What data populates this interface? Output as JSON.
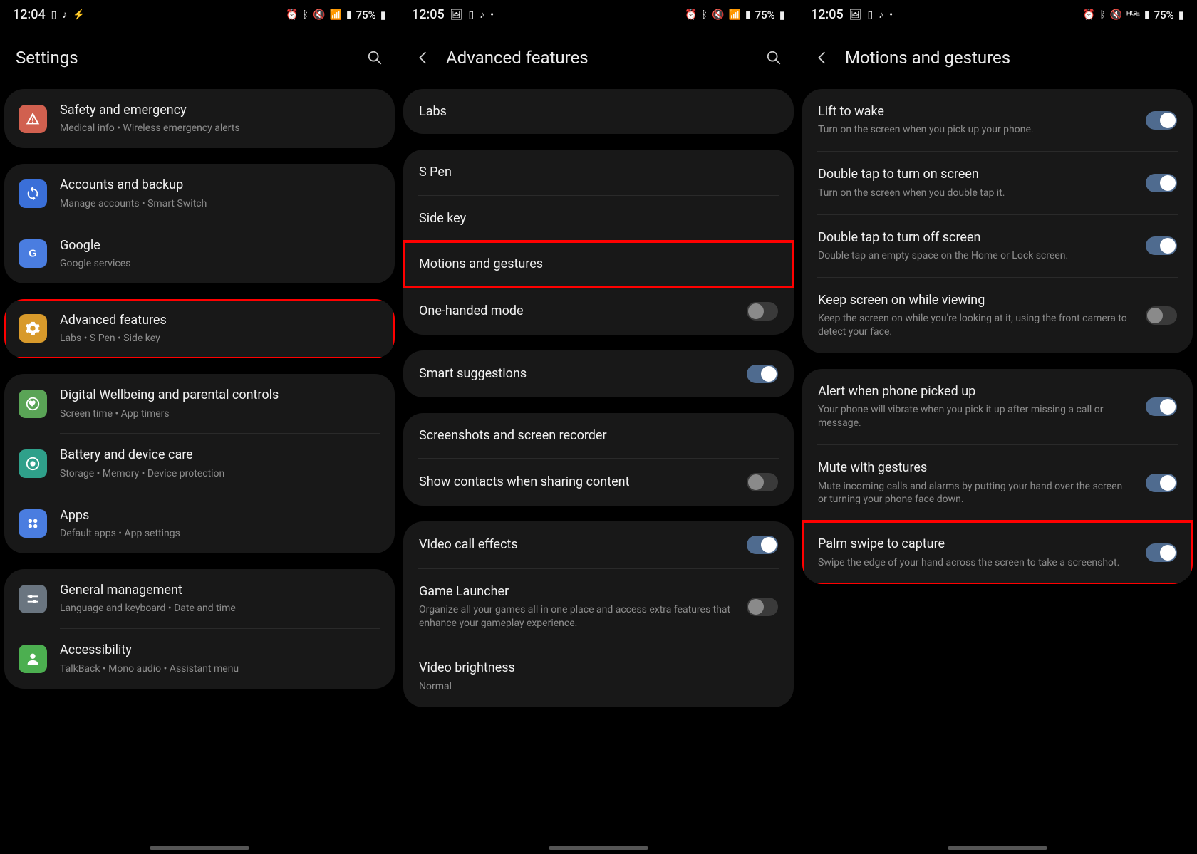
{
  "phones": [
    {
      "status": {
        "time": "12:04",
        "left_icons": [
          "sim-icon",
          "music-icon",
          "charging-icon"
        ],
        "right_icons": [
          "alarm",
          "bt",
          "mute",
          "wifi",
          "signal"
        ],
        "battery": "75%"
      },
      "title": "Settings",
      "has_back": false,
      "has_search": true,
      "sections": [
        {
          "items": [
            {
              "icon": "alert",
              "icon_bg": "bg-red",
              "title": "Safety and emergency",
              "subtitle": "Medical info  •  Wireless emergency alerts",
              "highlight": false
            }
          ]
        },
        {
          "items": [
            {
              "icon": "sync",
              "icon_bg": "bg-blue",
              "title": "Accounts and backup",
              "subtitle": "Manage accounts  •  Smart Switch"
            },
            {
              "icon": "google",
              "icon_bg": "bg-bluelight",
              "title": "Google",
              "subtitle": "Google services"
            }
          ]
        },
        {
          "items": [
            {
              "icon": "gear",
              "icon_bg": "bg-orange",
              "title": "Advanced features",
              "subtitle": "Labs  •  S Pen  •  Side key",
              "highlight": true
            }
          ]
        },
        {
          "items": [
            {
              "icon": "heart",
              "icon_bg": "bg-green",
              "title": "Digital Wellbeing and parental controls",
              "subtitle": "Screen time  •  App timers"
            },
            {
              "icon": "care",
              "icon_bg": "bg-teal",
              "title": "Battery and device care",
              "subtitle": "Storage  •  Memory  •  Device protection"
            },
            {
              "icon": "apps",
              "icon_bg": "bg-blue2",
              "title": "Apps",
              "subtitle": "Default apps  •  App settings"
            }
          ]
        },
        {
          "items": [
            {
              "icon": "sliders",
              "icon_bg": "bg-grey",
              "title": "General management",
              "subtitle": "Language and keyboard  •  Date and time"
            },
            {
              "icon": "person",
              "icon_bg": "bg-green2",
              "title": "Accessibility",
              "subtitle": "TalkBack  •  Mono audio  •  Assistant menu"
            }
          ]
        }
      ]
    },
    {
      "status": {
        "time": "12:05",
        "left_icons": [
          "image-icon",
          "sim-icon",
          "music-icon",
          "dot-icon"
        ],
        "right_icons": [
          "alarm",
          "bt",
          "mute",
          "wifi",
          "signal"
        ],
        "battery": "75%"
      },
      "title": "Advanced features",
      "has_back": true,
      "has_search": true,
      "sections": [
        {
          "simple": true,
          "items": [
            {
              "title": "Labs"
            }
          ]
        },
        {
          "simple": true,
          "items": [
            {
              "title": "S Pen"
            },
            {
              "title": "Side key"
            },
            {
              "title": "Motions and gestures",
              "highlight": true
            },
            {
              "title": "One-handed mode",
              "toggle": "off"
            }
          ]
        },
        {
          "simple": true,
          "items": [
            {
              "title": "Smart suggestions",
              "toggle": "on"
            }
          ]
        },
        {
          "simple": true,
          "items": [
            {
              "title": "Screenshots and screen recorder"
            },
            {
              "title": "Show contacts when sharing content",
              "toggle": "off"
            }
          ]
        },
        {
          "simple": true,
          "items": [
            {
              "title": "Video call effects",
              "toggle": "on"
            },
            {
              "title": "Game Launcher",
              "subtitle": "Organize all your games all in one place and access extra features that enhance your gameplay experience.",
              "toggle": "off"
            },
            {
              "title": "Video brightness",
              "subtitle": "Normal"
            }
          ]
        }
      ]
    },
    {
      "status": {
        "time": "12:05",
        "left_icons": [
          "image-icon",
          "sim-icon",
          "music-icon",
          "dot-icon"
        ],
        "right_icons": [
          "alarm",
          "bt",
          "mute",
          "4g",
          "signal"
        ],
        "battery": "75%"
      },
      "title": "Motions and gestures",
      "has_back": true,
      "has_search": false,
      "sections": [
        {
          "simple": true,
          "items": [
            {
              "title": "Lift to wake",
              "subtitle": "Turn on the screen when you pick up your phone.",
              "toggle": "on"
            },
            {
              "title": "Double tap to turn on screen",
              "subtitle": "Turn on the screen when you double tap it.",
              "toggle": "on"
            },
            {
              "title": "Double tap to turn off screen",
              "subtitle": "Double tap an empty space on the Home or Lock screen.",
              "toggle": "on"
            },
            {
              "title": "Keep screen on while viewing",
              "subtitle": "Keep the screen on while you're looking at it, using the front camera to detect your face.",
              "toggle": "off"
            }
          ]
        },
        {
          "simple": true,
          "items": [
            {
              "title": "Alert when phone picked up",
              "subtitle": "Your phone will vibrate when you pick it up after missing a call or message.",
              "toggle": "on"
            },
            {
              "title": "Mute with gestures",
              "subtitle": "Mute incoming calls and alarms by putting your hand over the screen or turning your phone face down.",
              "toggle": "on"
            },
            {
              "title": "Palm swipe to capture",
              "subtitle": "Swipe the edge of your hand across the screen to take a screenshot.",
              "toggle": "on",
              "highlight": true
            }
          ]
        }
      ]
    }
  ]
}
